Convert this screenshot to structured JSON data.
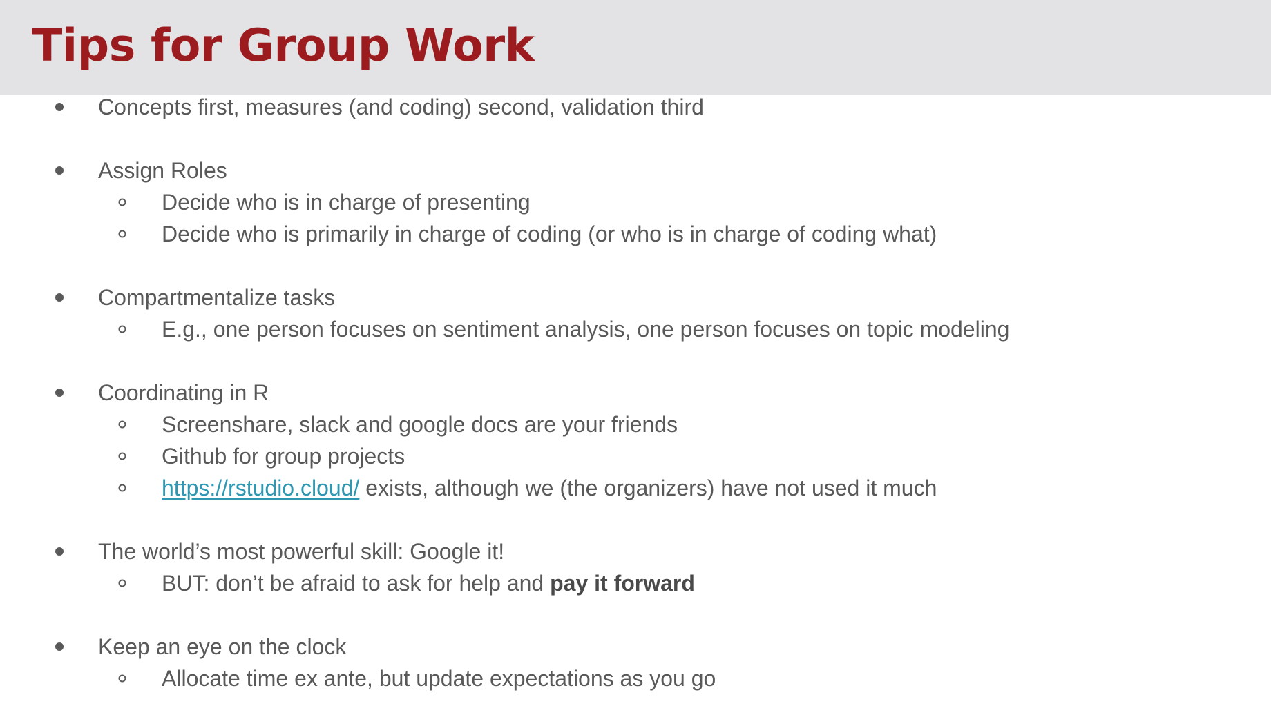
{
  "slide": {
    "title": "Tips for Group Work"
  },
  "bullets": [
    {
      "text": "Concepts first, measures (and coding) second, validation third",
      "sub": []
    },
    {
      "text": "Assign Roles",
      "sub": [
        {
          "text": "Decide who is in charge of presenting"
        },
        {
          "text": "Decide who is primarily in charge of coding (or who is in charge of coding what)"
        }
      ]
    },
    {
      "text": "Compartmentalize tasks",
      "sub": [
        {
          "text": "E.g., one person focuses on sentiment analysis, one person focuses on topic modeling"
        }
      ]
    },
    {
      "text": "Coordinating in R",
      "sub": [
        {
          "text": "Screenshare, slack and google docs are your friends"
        },
        {
          "text": "Github for group projects"
        },
        {
          "link": "https://rstudio.cloud/",
          "rest": " exists, although we (the organizers) have not used it much"
        }
      ]
    },
    {
      "text": "The world’s most powerful skill: Google it!",
      "sub": [
        {
          "before": "BUT: don’t be afraid to ask for help and ",
          "bold": "pay it forward"
        }
      ]
    },
    {
      "text": "Keep an eye on the clock",
      "sub": [
        {
          "text": "Allocate time ex ante, but update expectations as you go"
        }
      ]
    }
  ],
  "colors": {
    "title": "#9b1b1e",
    "title_bar": "#e3e2e4",
    "body_text": "#595959",
    "link": "#2e97b2"
  }
}
